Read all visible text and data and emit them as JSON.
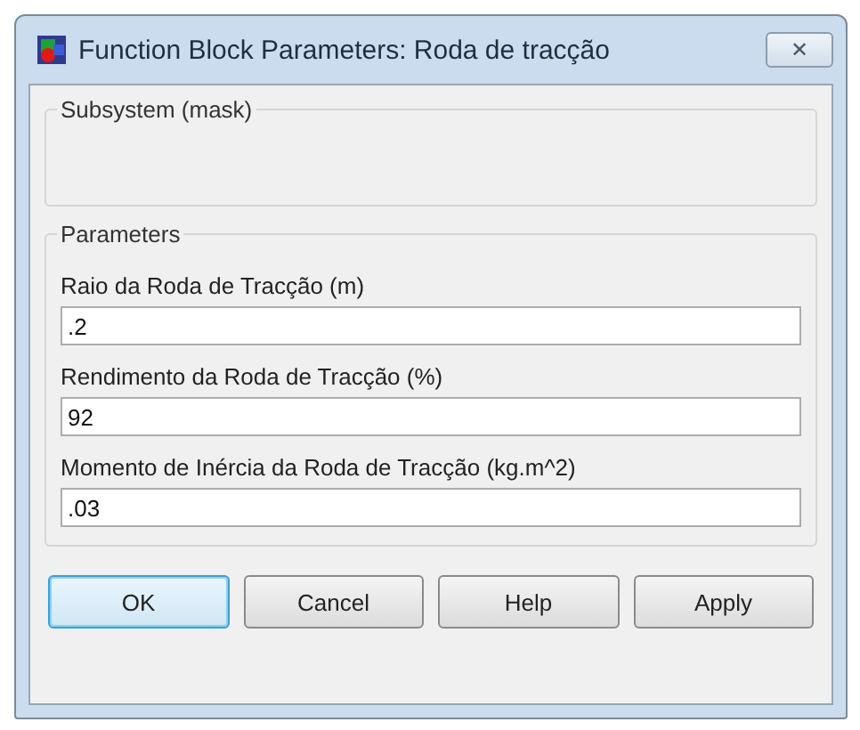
{
  "window": {
    "title": "Function Block Parameters: Roda de tracção",
    "close": "✕"
  },
  "description_group": {
    "title": "Subsystem (mask)"
  },
  "parameters_group": {
    "title": "Parameters",
    "fields": [
      {
        "label": "Raio da Roda de Tracção (m)",
        "value": ".2"
      },
      {
        "label": "Rendimento da Roda de Tracção (%)",
        "value": "92"
      },
      {
        "label": "Momento de Inércia da Roda de Tracção (kg.m^2)",
        "value": ".03"
      }
    ]
  },
  "buttons": [
    {
      "label": "OK",
      "default": true
    },
    {
      "label": "Cancel",
      "default": false
    },
    {
      "label": "Help",
      "default": false
    },
    {
      "label": "Apply",
      "default": false
    }
  ]
}
